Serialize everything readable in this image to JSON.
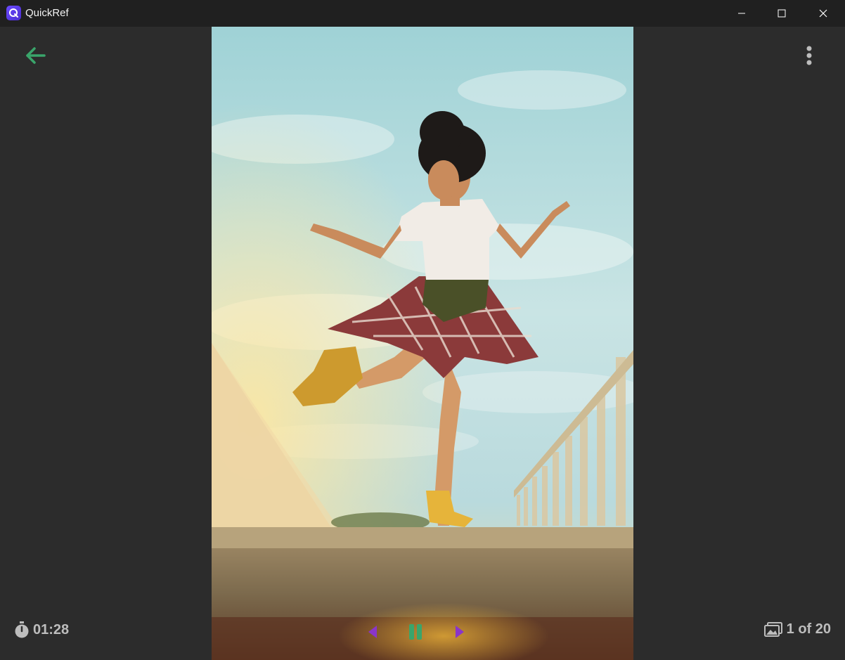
{
  "window": {
    "title": "QuickRef"
  },
  "colors": {
    "background": "#2c2c2c",
    "titlebar": "#202020",
    "accent_green": "#3aa56b",
    "accent_purple": "#8a35c9",
    "text_muted": "#bdbdbd"
  },
  "icons": {
    "app": "quickref-logo-icon",
    "back": "arrow-left-icon",
    "more": "more-vertical-icon",
    "timer": "stopwatch-icon",
    "images": "images-icon",
    "prev": "triangle-left-icon",
    "pause": "pause-icon",
    "next": "triangle-right-icon"
  },
  "session": {
    "timer": "01:28",
    "counter": "1 of 20"
  },
  "photo": {
    "alt": "Woman in white t-shirt and plaid shirt tied around waist balancing on one leg on a concrete ledge under a cloudy sky"
  }
}
